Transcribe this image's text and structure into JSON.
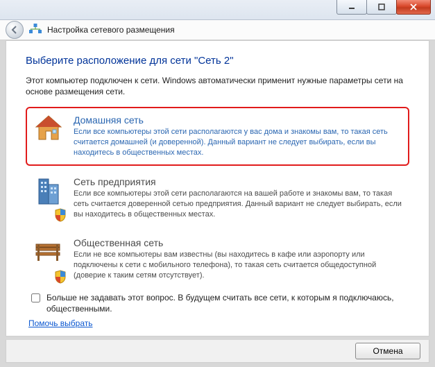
{
  "header": {
    "title": "Настройка сетевого размещения"
  },
  "main": {
    "heading": "Выберите расположение для сети \"Сеть  2\"",
    "intro": "Этот компьютер подключен к сети. Windows автоматически применит нужные параметры сети на основе размещения сети."
  },
  "options": {
    "home": {
      "title": "Домашняя сеть",
      "desc": "Если все компьютеры этой сети располагаются у вас дома и знакомы вам, то такая сеть считается домашней (и доверенной). Данный вариант не следует выбирать, если вы находитесь в общественных местах."
    },
    "work": {
      "title": "Сеть предприятия",
      "desc": "Если все компьютеры этой сети располагаются на вашей работе и знакомы вам, то такая сеть считается доверенной сетью предприятия. Данный вариант не следует выбирать, если вы находитесь в общественных местах."
    },
    "public": {
      "title": "Общественная сеть",
      "desc": "Если не все компьютеры вам известны (вы находитесь в кафе или аэропорту или подключены к сети с мобильного телефона), то такая сеть считается общедоступной (доверие к таким сетям отсутствует)."
    }
  },
  "checkbox": {
    "label": "Больше не задавать этот вопрос. В будущем считать все сети, к которым я подключаюсь, общественными."
  },
  "help_link": "Помочь выбрать",
  "footer": {
    "cancel": "Отмена"
  }
}
